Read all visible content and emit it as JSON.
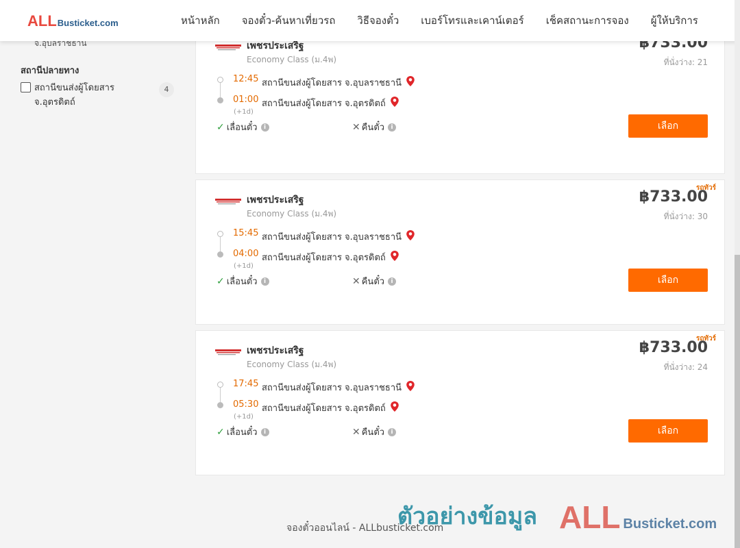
{
  "header": {
    "logo_big": "ALL",
    "logo_small": "Busticket.com",
    "nav": [
      "หน้าหลัก",
      "จองตั๋ว-ค้นหาเที่ยวรถ",
      "วิธีจองตั๋ว",
      "เบอร์โทรและเคาน์เตอร์",
      "เช็คสถานะการจอง",
      "ผู้ให้บริการ"
    ]
  },
  "sidebar": {
    "cut_text": "จ.อุบลราชธานี",
    "destination_title": "สถานีปลายทาง",
    "filter_label": "สถานีขนส่งผู้โดยสาร จ.อุตรดิตถ์",
    "filter_count": "4"
  },
  "trips": [
    {
      "tag": "",
      "operator": "เพชรประเสริฐ",
      "class": "Economy Class (ม.4พ)",
      "price": "฿733.00",
      "seats": "ที่นั่งว่าง: 21",
      "dep_time": "12:45",
      "dep_station": "สถานีขนส่งผู้โดยสาร จ.อุบลราชธานี",
      "arr_time": "01:00",
      "arr_station": "สถานีขนส่งผู้โดยสาร จ.อุตรดิตถ์",
      "next_day": "(+1d)",
      "policy_change": "เลื่อนตั๋ว",
      "policy_refund": "คืนตั๋ว",
      "button": "เลือก"
    },
    {
      "tag": "รถทัวร์",
      "operator": "เพชรประเสริฐ",
      "class": "Economy Class (ม.4พ)",
      "price": "฿733.00",
      "seats": "ที่นั่งว่าง: 30",
      "dep_time": "15:45",
      "dep_station": "สถานีขนส่งผู้โดยสาร จ.อุบลราชธานี",
      "arr_time": "04:00",
      "arr_station": "สถานีขนส่งผู้โดยสาร จ.อุตรดิตถ์",
      "next_day": "(+1d)",
      "policy_change": "เลื่อนตั๋ว",
      "policy_refund": "คืนตั๋ว",
      "button": "เลือก"
    },
    {
      "tag": "รถทัวร์",
      "operator": "เพชรประเสริฐ",
      "class": "Economy Class (ม.4พ)",
      "price": "฿733.00",
      "seats": "ที่นั่งว่าง: 24",
      "dep_time": "17:45",
      "dep_station": "สถานีขนส่งผู้โดยสาร จ.อุบลราชธานี",
      "arr_time": "05:30",
      "arr_station": "สถานีขนส่งผู้โดยสาร จ.อุตรดิตถ์",
      "next_day": "(+1d)",
      "policy_change": "เลื่อนตั๋ว",
      "policy_refund": "คืนตั๋ว",
      "button": "เลือก"
    }
  ],
  "footer": {
    "text": "จองตั๋วออนไลน์ - ALLbusticket.com",
    "watermark": "ตัวอย่างข้อมูล",
    "wm_logo_big": "ALL",
    "wm_logo_small": "Busticket.com"
  },
  "colors": {
    "accent": "#ff6a00",
    "time": "#e36a00",
    "logo_red": "#e8493f",
    "logo_blue": "#2a5d8c",
    "check": "#2e9e3c"
  },
  "icons": [
    "map-pin-icon",
    "check-icon",
    "x-icon",
    "info-icon",
    "operator-logo-icon"
  ]
}
